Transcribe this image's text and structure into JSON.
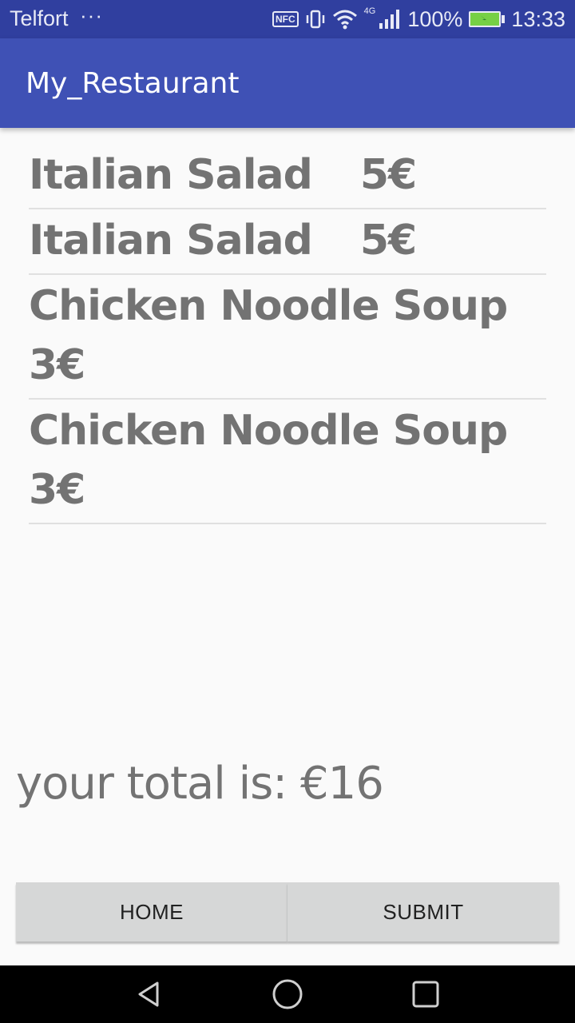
{
  "status_bar": {
    "carrier": "Telfort",
    "dots": "···",
    "nfc": "NFC",
    "network": "4G",
    "battery": "100%",
    "time": "13:33"
  },
  "app_bar": {
    "title": "My_Restaurant"
  },
  "order": {
    "items": [
      {
        "name": "Italian Salad",
        "price": "5€"
      },
      {
        "name": "Italian Salad",
        "price": "5€"
      },
      {
        "name": "Chicken Noodle Soup",
        "price": "3€"
      },
      {
        "name": "Chicken Noodle Soup",
        "price": "3€"
      }
    ],
    "total": "your total is: €16"
  },
  "buttons": {
    "home": "HOME",
    "submit": "SUBMIT"
  },
  "icons": {
    "more": "more-dots-icon",
    "vibrate": "vibrate-icon",
    "wifi": "wifi-icon",
    "signal": "signal-icon",
    "battery": "battery-charging-icon",
    "back": "back-icon",
    "home": "home-icon",
    "recents": "recents-icon"
  },
  "colors": {
    "status_bar": "#303f9f",
    "app_bar": "#3f51b5",
    "button": "#d6d7d7",
    "text": "#737373"
  }
}
